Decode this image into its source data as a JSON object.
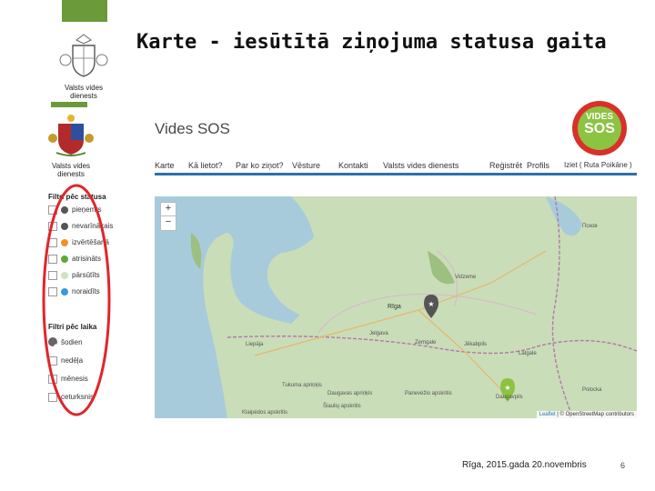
{
  "slide": {
    "title": "Karte - iesūtītā ziņojuma statusa gaita",
    "footer": "Rīga, 2015.gada 20.novembris",
    "page": "6",
    "accent": "#6b9a3a"
  },
  "logos": {
    "top_line1": "Valsts vides",
    "top_line2": "dienests",
    "small_line1": "Valsts vides",
    "small_line2": "dienests",
    "badge_line1": "VIDES",
    "badge_line2": "SOS"
  },
  "app": {
    "title": "Vides SOS",
    "nav": [
      "Karte",
      "Kā lietot?",
      "Par ko ziņot?",
      "Vēsture",
      "Kontakti",
      "Valsts vides dienests"
    ],
    "account": [
      "Reģistrēt",
      "Profils",
      "Iziet ( Ruta Poikāne )"
    ]
  },
  "filters": {
    "status_title": "Filtri pēc statusa",
    "status": [
      {
        "label": "pieņemts",
        "color": "#555555"
      },
      {
        "label": "nevarīnākais",
        "color": "#555555"
      },
      {
        "label": "izvērtēšanā",
        "color": "#f0922b"
      },
      {
        "label": "atrisināts",
        "color": "#5fa83a"
      },
      {
        "label": "pārsūtīts",
        "color": "#cfe3c0"
      },
      {
        "label": "noraidīts",
        "color": "#3a9ad9"
      }
    ],
    "time_title": "Filtri pēc laika",
    "time": [
      {
        "label": "šodien",
        "checked": true
      },
      {
        "label": "nedēļa",
        "checked": false
      },
      {
        "label": "mēnesis",
        "checked": false
      },
      {
        "label": "ceturksnis",
        "checked": false
      }
    ]
  },
  "map": {
    "zoom_in": "+",
    "zoom_out": "−",
    "attribution_leaflet": "Leaflet",
    "attribution_osm": "© OpenStreetMap contributors",
    "labels": [
      "Rīga",
      "Jelgava",
      "Zemgale",
      "Vidzeme",
      "Latgale",
      "Daugavpils",
      "Jēkabpils",
      "Liepāja",
      "Псков",
      "Tukuma apriņķis",
      "Daugavas apriņķis",
      "Panevėžio apskritis",
      "Šiaulių apskritis",
      "Klaipėdos apskritis",
      "Polocka"
    ]
  }
}
